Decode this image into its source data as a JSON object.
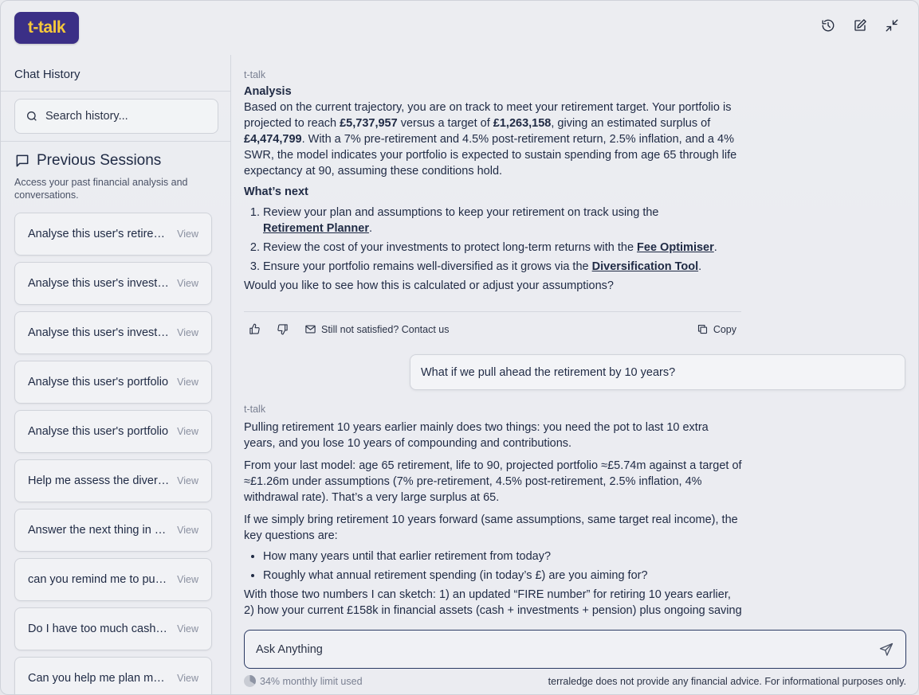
{
  "app": {
    "logo_text": "t-talk"
  },
  "sidebar": {
    "title": "Chat History",
    "search_placeholder": "Search history...",
    "previous_title": "Previous Sessions",
    "previous_desc": "Access your past financial analysis and conversations.",
    "view_label": "View",
    "sessions": [
      "Analyse this user's retirement",
      "Analyse this user's investments",
      "Analyse this user's investments",
      "Analyse this user's portfolio",
      "Analyse this user's portfolio",
      "Help me assess the diversification",
      "Answer the next thing in order",
      "can you remind me to  put money",
      "Do I have too much cash for",
      "Can you help me plan my retirement"
    ]
  },
  "chat": {
    "msg1": {
      "sender": "t-talk",
      "heading": "Analysis",
      "p1_a": "Based on the current trajectory, you are on track to meet your retirement target. Your portfolio is projected to reach ",
      "p1_v1": "£5,737,957",
      "p1_b": " versus a target of ",
      "p1_v2": "£1,263,158",
      "p1_c": ", giving an estimated surplus of ",
      "p1_v3": "£4,474,799",
      "p1_d": ". With a 7% pre-retirement and 4.5% post-retirement return, 2.5% inflation, and a 4% SWR, the model indicates your portfolio is expected to sustain spending from age 65 through life expectancy at 90, assuming these conditions hold.",
      "next_heading": "What’s next",
      "step1_a": "Review your plan and assumptions to keep your retirement on track using the ",
      "step1_link": "Retirement Planner",
      "step2_a": "Review the cost of your investments to protect long-term returns with the ",
      "step2_link": "Fee Optimiser",
      "step3_a": "Ensure your portfolio remains well-diversified as it grows via the ",
      "step3_link": "Diversification Tool",
      "dot": ".",
      "question": "Would you like to see how this is calculated or adjust your assumptions?"
    },
    "actions": {
      "contact": "Still not satisfied? Contact us",
      "copy": "Copy"
    },
    "user_msg": "What if we pull ahead the retirement by 10 years?",
    "msg2": {
      "sender": "t-talk",
      "p1": "Pulling retirement 10 years earlier mainly does two things: you need the pot to last 10 extra years, and you lose 10 years of compounding and contributions.",
      "p2": "From your last model: age 65 retirement, life to 90, projected portfolio ≈£5.74m against a target of ≈£1.26m under assumptions (7% pre-retirement, 4.5% post-retirement, 2.5% inflation, 4% withdrawal rate). That’s a very large surplus at 65.",
      "p3": "If we simply bring retirement 10 years forward (same assumptions, same target real income), the key questions are:",
      "b1": "How many years until that earlier retirement from today?",
      "b2": "Roughly what annual retirement spending (in today’s £) are you aiming for?",
      "p4": "With those two numbers I can sketch: 1) an updated “FIRE number” for retiring 10 years earlier, 2) how your current £158k in financial assets (cash + investments + pension) plus ongoing saving"
    },
    "composer_placeholder": "Ask Anything",
    "usage_text": "34% monthly limit used",
    "usage_fraction": 0.34,
    "disclaimer": "terraledge does not provide any financial advice. For informational purposes only."
  }
}
